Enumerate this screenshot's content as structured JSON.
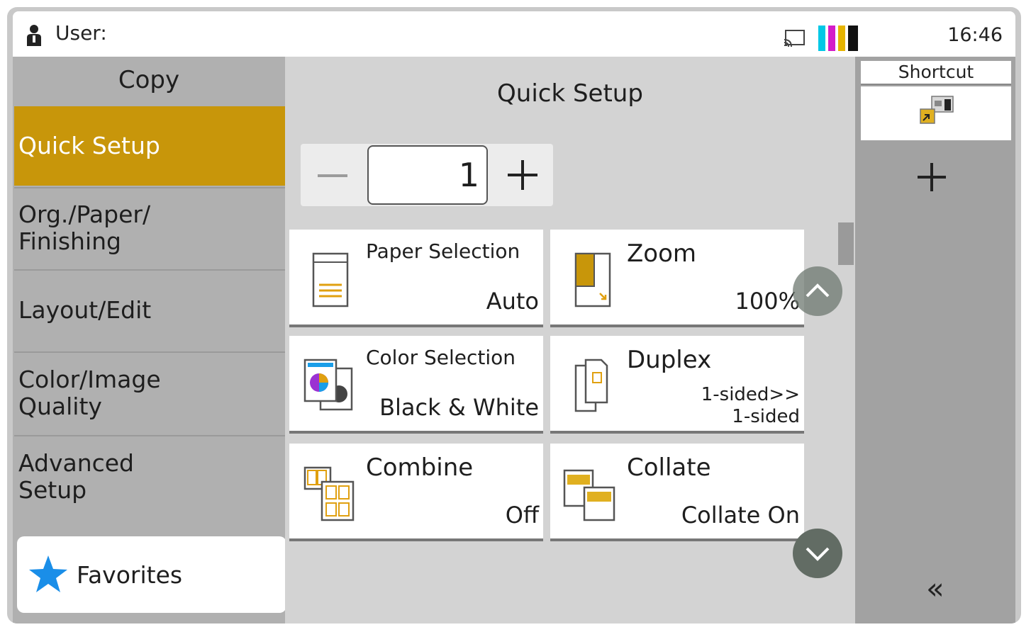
{
  "status_bar": {
    "user_label": "User:",
    "time": "16:46",
    "toner_colors": [
      "#00c8e6",
      "#d41cc8",
      "#e6b400",
      "#111111"
    ]
  },
  "sidebar": {
    "title": "Copy",
    "items": [
      {
        "label": "Quick Setup",
        "active": true
      },
      {
        "label": "Org./Paper/\nFinishing",
        "active": false
      },
      {
        "label": "Layout/Edit",
        "active": false
      },
      {
        "label": "Color/Image\nQuality",
        "active": false
      },
      {
        "label": "Advanced\nSetup",
        "active": false
      }
    ],
    "favorites_label": "Favorites"
  },
  "main": {
    "title": "Quick Setup",
    "copies": "1",
    "tiles": [
      {
        "name": "Paper Selection",
        "value": "Auto",
        "icon": "paper-tray-icon"
      },
      {
        "name": "Zoom",
        "value": "100%",
        "icon": "zoom-icon"
      },
      {
        "name": "Color Selection",
        "value": "Black & White",
        "icon": "color-selection-icon"
      },
      {
        "name": "Duplex",
        "value_line1": "1-sided>>",
        "value_line2": "1-sided",
        "icon": "duplex-icon"
      },
      {
        "name": "Combine",
        "value": "Off",
        "icon": "combine-icon"
      },
      {
        "name": "Collate",
        "value": "Collate On",
        "icon": "collate-icon"
      }
    ]
  },
  "right_panel": {
    "shortcut_label": "Shortcut",
    "collapse_glyph": "«"
  },
  "colors": {
    "accent": "#c8960a",
    "favorites_star": "#1a8ee8"
  }
}
